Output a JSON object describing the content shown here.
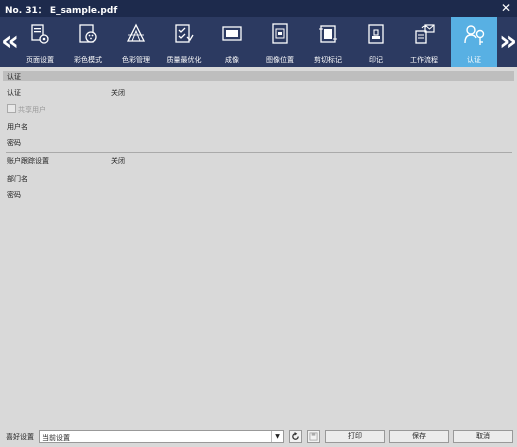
{
  "window": {
    "title": "No. 31： E_sample.pdf",
    "close": "✕"
  },
  "toolbar": {
    "prev": "«",
    "next": "»",
    "tabs": [
      {
        "label": "页面设置",
        "icon": "page-setup-icon"
      },
      {
        "label": "彩色模式",
        "icon": "color-mode-icon"
      },
      {
        "label": "色彩管理",
        "icon": "color-management-icon"
      },
      {
        "label": "质量最优化",
        "icon": "quality-optimize-icon"
      },
      {
        "label": "成像",
        "icon": "imaging-icon"
      },
      {
        "label": "图像位置",
        "icon": "image-position-icon"
      },
      {
        "label": "剪切标记",
        "icon": "crop-marks-icon"
      },
      {
        "label": "印记",
        "icon": "stamp-icon"
      },
      {
        "label": "工作流程",
        "icon": "workflow-icon"
      },
      {
        "label": "认证",
        "icon": "authentication-icon",
        "active": true
      }
    ]
  },
  "section": {
    "title": "认证",
    "auth_label": "认证",
    "auth_value": "关闭",
    "shared_user_label": "共享用户",
    "username_label": "用户名",
    "password_label": "密码",
    "account_label": "账户跟踪设置",
    "account_value": "关闭",
    "dept_label": "部门名",
    "password2_label": "密码"
  },
  "bottom": {
    "preference_label": "喜好设置",
    "preference_value": "当前设置",
    "print_label": "打印",
    "save_label": "保存",
    "cancel_label": "取消"
  },
  "colors": {
    "titlebar": "#1d2a4c",
    "toolbar": "#2c3a61",
    "active_tab": "#58b0e3"
  }
}
